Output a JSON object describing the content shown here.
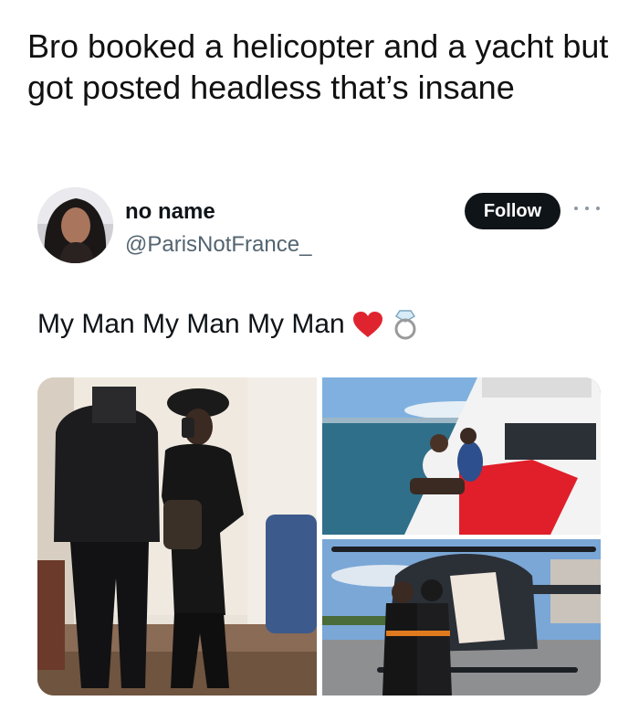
{
  "caption": "Bro booked a helicopter and a yacht but got posted headless that’s insane",
  "tweet": {
    "display_name": "no name",
    "handle": "@ParisNotFrance_",
    "follow_label": "Follow",
    "text": "My Man My Man My Man",
    "emojis": [
      "red-heart",
      "ring"
    ],
    "colors": {
      "follow_bg": "#0f1419",
      "handle": "#536471",
      "heart": "#e0242f"
    }
  },
  "media": {
    "photos": [
      "couple-mirror-photo",
      "yacht-photo",
      "helicopter-photo"
    ]
  }
}
